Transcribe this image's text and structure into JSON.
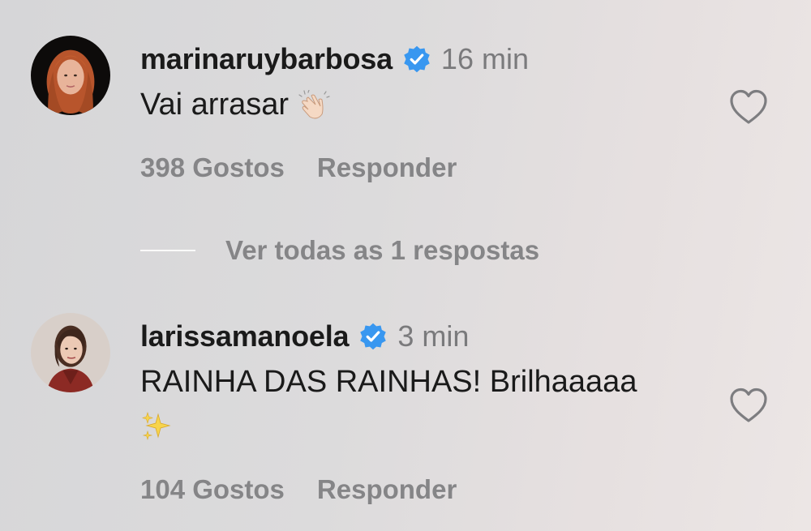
{
  "comments": [
    {
      "username": "marinaruybarbosa",
      "verified": true,
      "time": "16 min",
      "text": "Vai arrasar",
      "emoji": "clapping-hands-emoji",
      "likes": "398 Gostos",
      "reply_label": "Responder",
      "view_replies": "Ver todas as 1 respostas"
    },
    {
      "username": "larissamanoela",
      "verified": true,
      "time": "3 min",
      "text": "RAINHA DAS RAINHAS! Brilhaaaaa",
      "emoji": "sparkles-emoji",
      "likes": "104 Gostos",
      "reply_label": "Responder"
    }
  ],
  "colors": {
    "verified_badge": "#3897f0",
    "username": "#1a1a1a",
    "secondary_text": "#858587",
    "time": "#7a7a7c"
  }
}
